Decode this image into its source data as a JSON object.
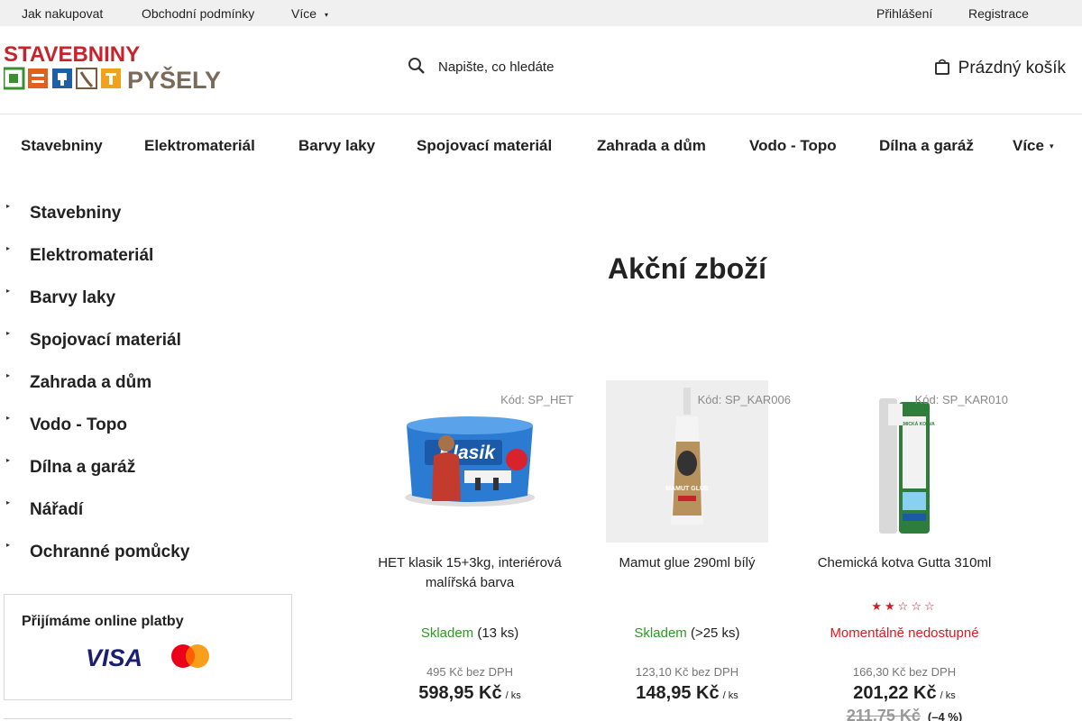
{
  "topbar": {
    "links": [
      "Jak nakupovat",
      "Obchodní podmínky",
      "Více"
    ],
    "login": "Přihlášení",
    "register": "Registrace"
  },
  "header": {
    "logo_text_top": "STAVEBNINY",
    "logo_text_bottom": "PYŠELY",
    "search_placeholder": "Napište, co hledáte",
    "cart_label": "Prázdný košík"
  },
  "nav": {
    "items": [
      "Stavebniny",
      "Elektromateriál",
      "Barvy laky",
      "Spojovací materiál",
      "Zahrada a dům",
      "Vodo - Topo",
      "Dílna a garáž",
      "Více"
    ]
  },
  "sidebar": {
    "categories": [
      "Stavebniny",
      "Elektromateriál",
      "Barvy laky",
      "Spojovací materiál",
      "Zahrada a dům",
      "Vodo - Topo",
      "Dílna a garáž",
      "Nářadí",
      "Ochranné pomůcky"
    ],
    "payments_title": "Přijímáme online platby",
    "visa_text": "VISA"
  },
  "main": {
    "title": "Akční zboží"
  },
  "products": [
    {
      "code": "Kód: SP_HET",
      "image_text": "Klasik",
      "name": "HET klasik 15+3kg, interiérová malířská barva",
      "stock_status": "Skladem",
      "stock_count": "(13 ks)",
      "price_no_vat": "495 Kč bez DPH",
      "price": "598,95 Kč",
      "unit": "/ ks"
    },
    {
      "code": "Kód: SP_KAR006",
      "image_text": "MAMUT GLUE",
      "name": "Mamut glue 290ml bílý",
      "stock_status": "Skladem",
      "stock_count": "(>25 ks)",
      "price_no_vat": "123,10 Kč bez DPH",
      "price": "148,95 Kč",
      "unit": "/ ks"
    },
    {
      "code": "Kód: SP_KAR010",
      "image_text": "CHEMICKÁ KOTVA",
      "name": "Chemická kotva Gutta 310ml",
      "rating": 2,
      "rating_max": 5,
      "stock_status": "Momentálně nedostupné",
      "price_no_vat": "166,30 Kč bez DPH",
      "price": "201,22 Kč",
      "unit": "/ ks",
      "old_price": "211,75 Kč",
      "discount": "(–4 %)"
    }
  ],
  "colors": {
    "brand_red": "#c8232c",
    "in_stock": "#2c9b22",
    "unavailable": "#d81b24",
    "topbar_bg": "#f0f0f0"
  }
}
